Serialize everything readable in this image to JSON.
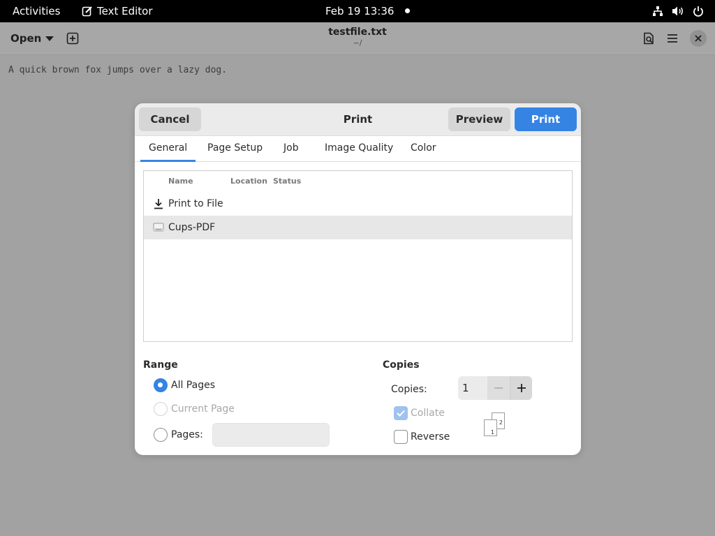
{
  "topbar": {
    "activities": "Activities",
    "app_name": "Text Editor",
    "datetime": "Feb 19  13:36"
  },
  "editor": {
    "open_label": "Open",
    "title": "testfile.txt",
    "subtitle": "~/",
    "content": "A quick brown fox jumps over a lazy dog."
  },
  "dialog": {
    "title": "Print",
    "cancel_label": "Cancel",
    "preview_label": "Preview",
    "print_label": "Print",
    "accent": "#3584e4",
    "tabs": [
      {
        "label": "General",
        "active": true
      },
      {
        "label": "Page Setup"
      },
      {
        "label": "Job"
      },
      {
        "label": "Image Quality"
      },
      {
        "label": "Color"
      }
    ],
    "printer_columns": [
      "Name",
      "Location",
      "Status"
    ],
    "printers": [
      {
        "name": "Print to File",
        "icon": "download-icon",
        "selected": false
      },
      {
        "name": "Cups-PDF",
        "icon": "printer-icon",
        "selected": true
      }
    ],
    "range": {
      "heading": "Range",
      "all_pages": "All Pages",
      "current_page": "Current Page",
      "pages": "Pages:",
      "pages_value": "",
      "selected": "all_pages"
    },
    "copies": {
      "heading": "Copies",
      "label": "Copies:",
      "value": "1",
      "collate": "Collate",
      "collate_checked": true,
      "reverse": "Reverse",
      "reverse_checked": false,
      "collate_pages": [
        "1",
        "2"
      ]
    }
  }
}
